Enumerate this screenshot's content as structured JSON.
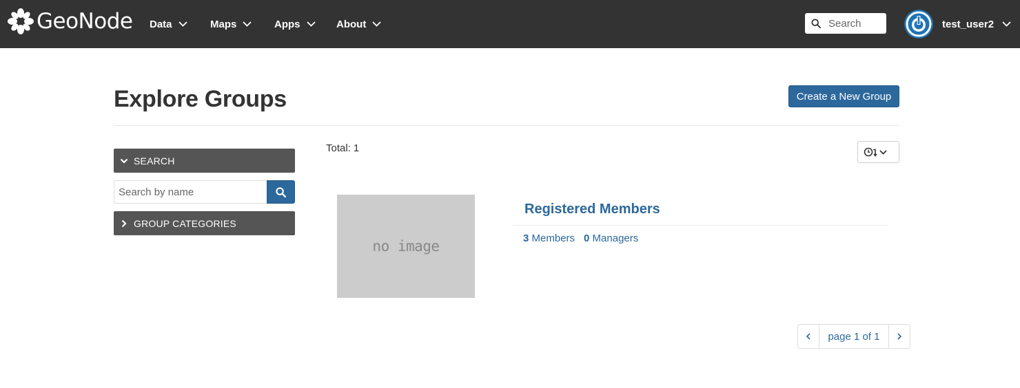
{
  "navbar": {
    "brand": "GeoNode",
    "items": [
      {
        "label": "Data",
        "icon": "chevron-down-icon"
      },
      {
        "label": "Maps",
        "icon": "chevron-down-icon"
      },
      {
        "label": "Apps",
        "icon": "chevron-down-icon"
      },
      {
        "label": "About",
        "icon": "chevron-down-icon"
      }
    ],
    "search": {
      "placeholder": "Search",
      "value": "",
      "icon": "search-icon"
    },
    "user": {
      "name": "test_user2",
      "avatar_icon": "power-icon"
    }
  },
  "header": {
    "title": "Explore Groups",
    "create_button": "Create a New Group"
  },
  "sidebar": {
    "search_panel": {
      "label": "SEARCH",
      "icon": "chevron-down-icon"
    },
    "name_search": {
      "placeholder": "Search by name",
      "value": "",
      "icon": "search-icon"
    },
    "categories_panel": {
      "label": "GROUP CATEGORIES",
      "icon": "chevron-right-icon"
    }
  },
  "results": {
    "total_label": "Total:",
    "total_value": "1",
    "sort_icon": "clock-sort-icon",
    "groups": [
      {
        "title": "Registered Members",
        "thumbnail_text": "no image",
        "members_count": "3",
        "members_label": "Members",
        "managers_count": "0",
        "managers_label": "Managers"
      }
    ]
  },
  "pagination": {
    "label": "page 1 of 1",
    "prev_icon": "chevron-left-icon",
    "next_icon": "chevron-right-icon"
  },
  "colors": {
    "navbar_bg": "#333333",
    "primary": "#2c689c",
    "panel_bg": "#555555",
    "thumbnail_bg": "#cccccc"
  }
}
